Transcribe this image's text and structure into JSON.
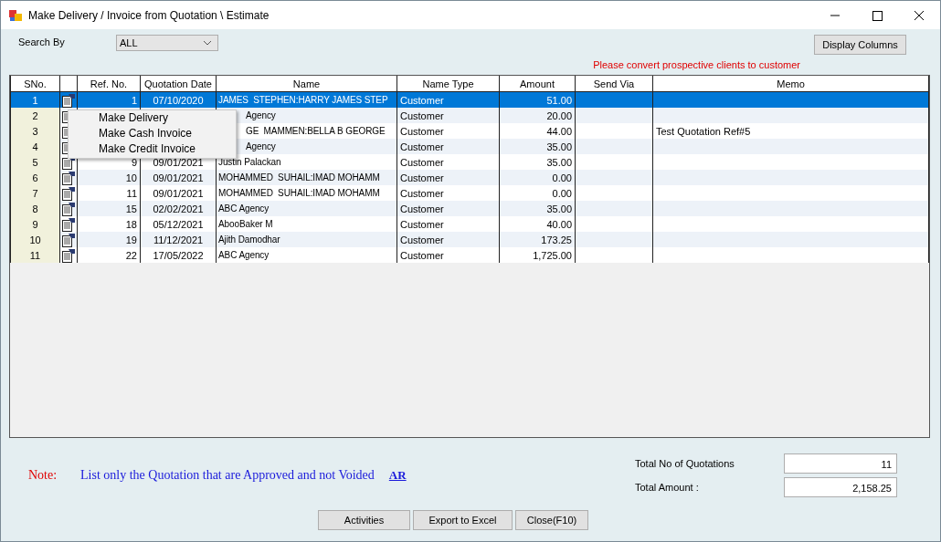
{
  "window": {
    "title": "Make Delivery / Invoice from Quotation \\ Estimate"
  },
  "search": {
    "label": "Search By",
    "value": "ALL"
  },
  "display_columns_button": "Display Columns",
  "warning": "Please convert prospective clients to customer",
  "table": {
    "columns": [
      "SNo.",
      "",
      "Ref. No.",
      "Quotation Date",
      "Name",
      "Name Type",
      "Amount",
      "Send Via",
      "Memo"
    ],
    "rows": [
      {
        "sno": "1",
        "ref": "1",
        "date": "07/10/2020",
        "name": "JAMES  STEPHEN:HARRY JAMES STEP",
        "name_type": "Customer",
        "amount": "51.00",
        "selected": true
      },
      {
        "sno": "2",
        "name": "Agency",
        "name_type": "Customer",
        "amount": "20.00",
        "selected": false
      },
      {
        "sno": "3",
        "name": "GE  MAMMEN:BELLA B GEORGE",
        "name_type": "Customer",
        "amount": "44.00",
        "memo": "Test Quotation Ref#5",
        "selected": false
      },
      {
        "sno": "4",
        "name": "Agency",
        "name_type": "Customer",
        "amount": "35.00",
        "selected": false
      },
      {
        "sno": "5",
        "ref": "9",
        "date": "09/01/2021",
        "name": "Justin Palackan",
        "name_type": "Customer",
        "amount": "35.00",
        "selected": false
      },
      {
        "sno": "6",
        "ref": "10",
        "date": "09/01/2021",
        "name": "MOHAMMED  SUHAIL:IMAD MOHAMM",
        "name_type": "Customer",
        "amount": "0.00",
        "selected": false
      },
      {
        "sno": "7",
        "ref": "11",
        "date": "09/01/2021",
        "name": "MOHAMMED  SUHAIL:IMAD MOHAMM",
        "name_type": "Customer",
        "amount": "0.00",
        "selected": false
      },
      {
        "sno": "8",
        "ref": "15",
        "date": "02/02/2021",
        "name": "ABC Agency",
        "name_type": "Customer",
        "amount": "35.00",
        "selected": false
      },
      {
        "sno": "9",
        "ref": "18",
        "date": "05/12/2021",
        "name": "AbooBaker M",
        "name_type": "Customer",
        "amount": "40.00",
        "selected": false
      },
      {
        "sno": "10",
        "ref": "19",
        "date": "11/12/2021",
        "name": "Ajith Damodhar",
        "name_type": "Customer",
        "amount": "173.25",
        "selected": false
      },
      {
        "sno": "11",
        "ref": "22",
        "date": "17/05/2022",
        "name": "ABC Agency",
        "name_type": "Customer",
        "amount": "1,725.00",
        "selected": false
      }
    ]
  },
  "context_menu": [
    "Make Delivery",
    "Make Cash Invoice",
    "Make Credit Invoice"
  ],
  "note": {
    "label": "Note:",
    "text": "List only the Quotation that are Approved and not Voided",
    "link": "AR"
  },
  "totals": [
    {
      "label": "Total No of Quotations",
      "value": "11"
    },
    {
      "label": "Total Amount :",
      "value": "2,158.25"
    }
  ],
  "buttons": [
    "Activities",
    "Export to Excel",
    "Close(F10)"
  ]
}
